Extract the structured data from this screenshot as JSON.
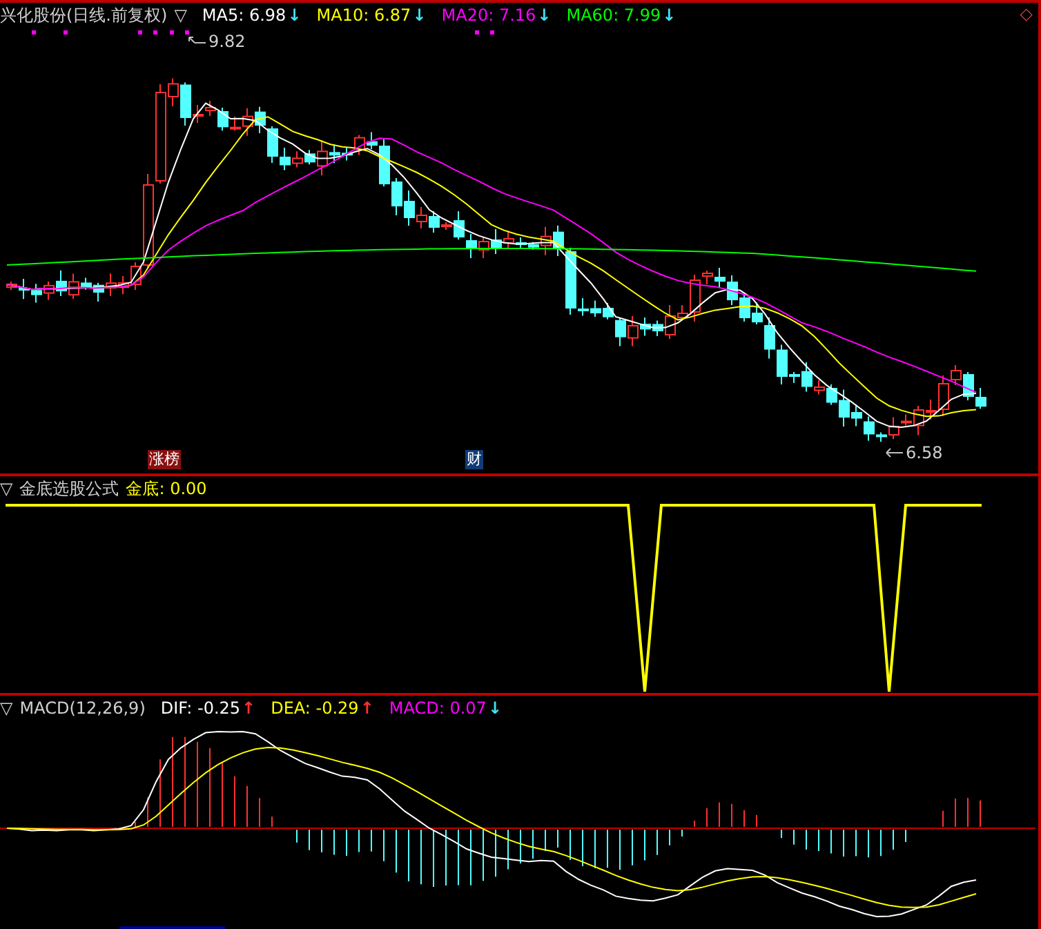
{
  "price_panel": {
    "title": "兴化股份(日线.前复权)",
    "marker": "▽",
    "corner_icon": "◇",
    "indicators": [
      {
        "label": "MA5: 6.98",
        "color": "#ffffff",
        "arrow": "↓",
        "kind": "falling"
      },
      {
        "label": "MA10: 6.87",
        "color": "#ffff00",
        "arrow": "↓",
        "kind": "falling"
      },
      {
        "label": "MA20: 7.16",
        "color": "#ff00ff",
        "arrow": "↓",
        "kind": "falling"
      },
      {
        "label": "MA60: 7.99",
        "color": "#00ff00",
        "arrow": "↓",
        "kind": "falling"
      }
    ],
    "high_label": "9.82",
    "low_label": "6.58",
    "badges": [
      {
        "text": "涨榜",
        "kind": "limit-up"
      },
      {
        "text": "财",
        "kind": "finance"
      }
    ]
  },
  "formula_panel": {
    "marker": "▽",
    "title": "金底选股公式",
    "indicators": [
      {
        "label": "金底: 0.00",
        "color": "#ffff00"
      }
    ]
  },
  "macd_panel": {
    "marker": "▽",
    "title": "MACD(12,26,9)",
    "indicators": [
      {
        "label": "DIF: -0.25",
        "color": "#ffffff",
        "arrow": "↑",
        "kind": "rising"
      },
      {
        "label": "DEA: -0.29",
        "color": "#ffff00",
        "arrow": "↑",
        "kind": "rising"
      },
      {
        "label": "MACD: 0.07",
        "color": "#ff00ff",
        "arrow": "↓",
        "kind": "falling"
      }
    ]
  }
}
